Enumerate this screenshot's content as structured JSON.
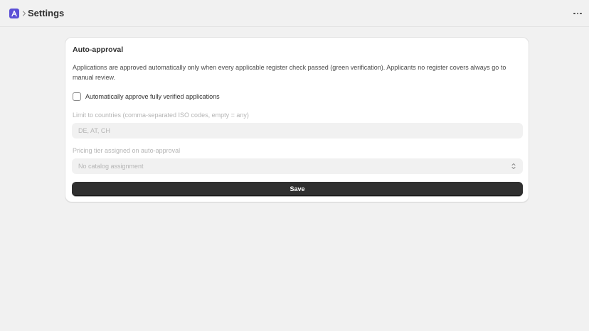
{
  "header": {
    "title": "Settings",
    "app_icon": "app-logo-icon",
    "more_icon": "more-horizontal-icon"
  },
  "card": {
    "title": "Auto-approval",
    "description": "Applications are approved automatically only when every applicable register check passed (green verification). Applicants no register covers always go to manual review.",
    "checkbox_label": "Automatically approve fully verified applications",
    "checkbox_checked": false,
    "countries_label": "Limit to countries (comma-separated ISO codes, empty = any)",
    "countries_placeholder": "DE, AT, CH",
    "pricing_label": "Pricing tier assigned on auto-approval",
    "pricing_value": "No catalog assignment",
    "save_label": "Save"
  },
  "colors": {
    "background": "#f1f1f1",
    "accent": "#5b4fd6",
    "button": "#303030"
  }
}
